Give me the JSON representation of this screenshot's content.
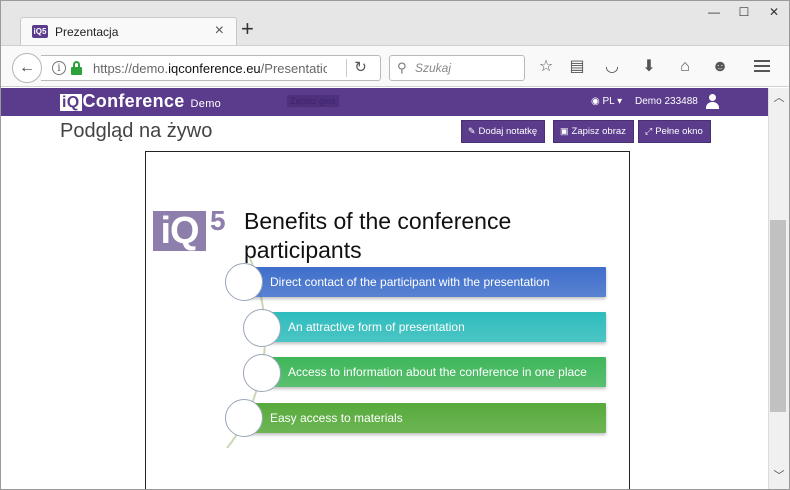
{
  "browser": {
    "tab_title": "Prezentacja",
    "favicon_text": "iQ5",
    "url_prefix": "https://demo.",
    "url_domain": "iqconference.eu",
    "url_suffix": "/Presentatior",
    "search_placeholder": "Szukaj",
    "icons": [
      "back-arrow-icon",
      "info-icon",
      "lock-icon",
      "reload-icon",
      "search-icon",
      "bookmark-star-icon",
      "reading-list-icon",
      "pocket-icon",
      "download-icon",
      "home-icon",
      "smiley-icon",
      "menu-icon"
    ]
  },
  "header": {
    "logo_iq": "iQ",
    "logo_rest": "Conference",
    "logo_demo": "Demo",
    "ghost_link": "Zapisz głos",
    "lang": "PL",
    "user": "Demo 233488",
    "colors": {
      "brand": "#5b3b8c"
    }
  },
  "page": {
    "title": "Podgląd na żywo",
    "buttons": {
      "add_note": "Dodaj notatkę",
      "save_image": "Zapisz obraz",
      "full_window": "Pełne okno"
    }
  },
  "slide": {
    "logo_main": "iQ",
    "logo_sup": "5",
    "title": "Benefits of the conference participants",
    "items": [
      {
        "label": "Direct contact of the participant with the presentation",
        "color": "#3f6fcb"
      },
      {
        "label": "An attractive form of presentation",
        "color": "#2fbcbc"
      },
      {
        "label": "Access to information about the conference in one place",
        "color": "#3fb65a"
      },
      {
        "label": "Easy access to materials",
        "color": "#57aa3b"
      }
    ]
  }
}
